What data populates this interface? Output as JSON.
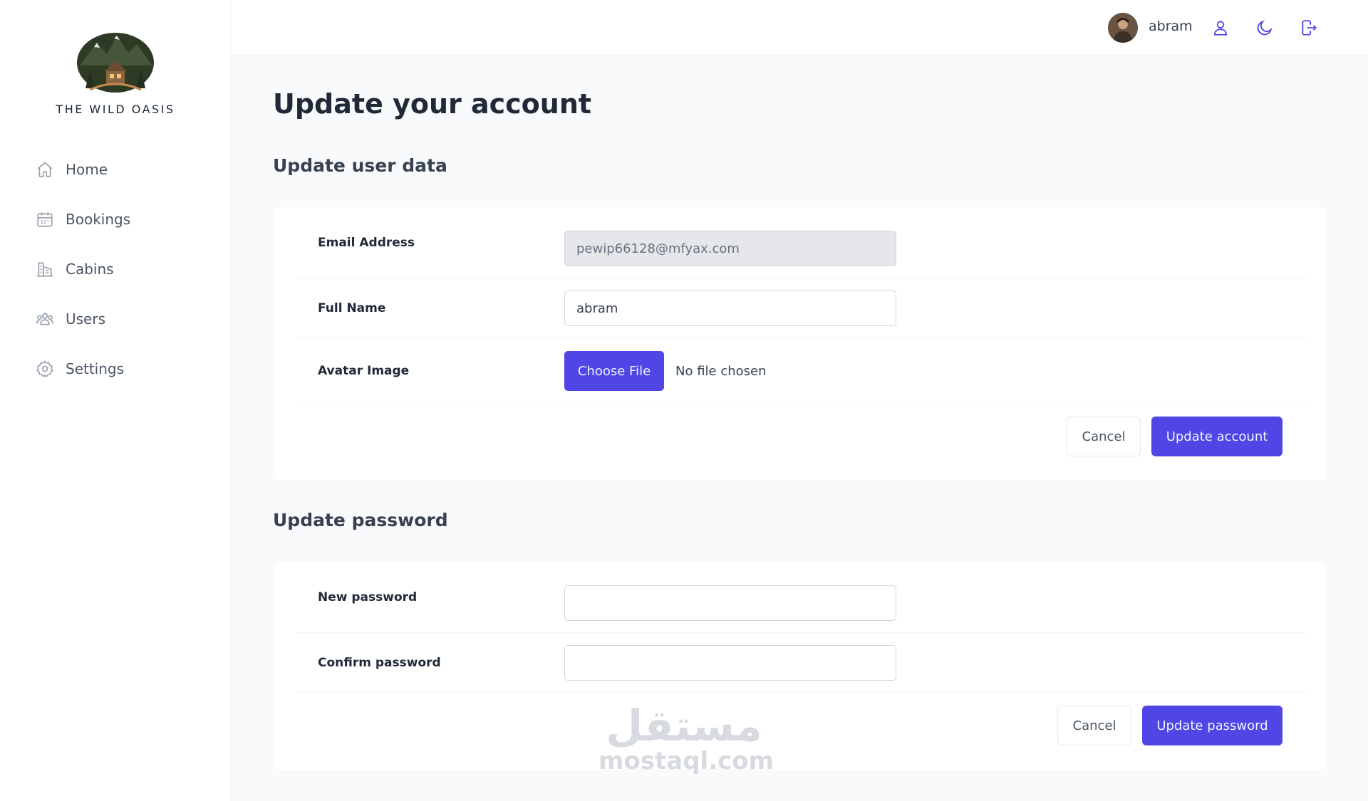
{
  "sidebar": {
    "logo_text": "THE WILD OASIS",
    "items": [
      {
        "label": "Home",
        "icon": "home-icon"
      },
      {
        "label": "Bookings",
        "icon": "calendar-icon"
      },
      {
        "label": "Cabins",
        "icon": "buildings-icon"
      },
      {
        "label": "Users",
        "icon": "users-icon"
      },
      {
        "label": "Settings",
        "icon": "gear-icon"
      }
    ]
  },
  "header": {
    "username": "abram",
    "icons": [
      "user-icon",
      "moon-icon",
      "logout-icon"
    ]
  },
  "page": {
    "title": "Update your account"
  },
  "user_data": {
    "section_title": "Update user data",
    "email_label": "Email Address",
    "email_value": "pewip66128@mfyax.com",
    "fullname_label": "Full Name",
    "fullname_value": "abram",
    "avatar_label": "Avatar Image",
    "choose_file": "Choose File",
    "file_status": "No file chosen",
    "cancel": "Cancel",
    "submit": "Update account"
  },
  "password": {
    "section_title": "Update password",
    "new_label": "New password",
    "new_value": "",
    "confirm_label": "Confirm password",
    "confirm_value": "",
    "cancel": "Cancel",
    "submit": "Update password"
  },
  "watermark": {
    "arabic": "مستقل",
    "latin": "mostaql.com"
  },
  "colors": {
    "accent": "#4f46e5",
    "background": "#f9fafb",
    "surface": "#ffffff"
  }
}
